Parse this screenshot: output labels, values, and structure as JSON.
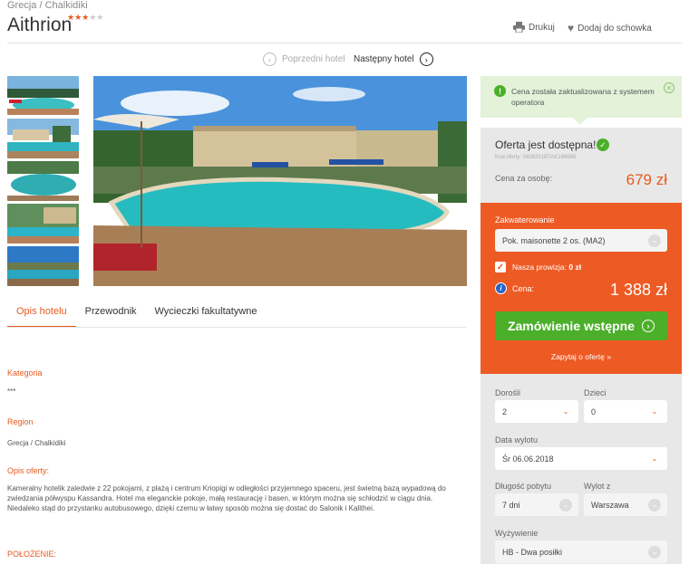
{
  "breadcrumb": "Grecja / Chalkidiki",
  "hotel_name": "Aithrion",
  "rating": {
    "stars_on": 3,
    "stars_total": 5
  },
  "actions": {
    "print": "Drukuj",
    "favourite": "Dodaj do schowka"
  },
  "pager": {
    "prev": "Poprzedni hotel",
    "next": "Następny hotel"
  },
  "tabs": [
    "Opis hotelu",
    "Przewodnik",
    "Wycieczki fakultatywne"
  ],
  "description": {
    "category_label": "Kategoria",
    "category_value": "***",
    "region_label": "Region",
    "region_value": "Grecja / Chalkidiki",
    "offer_label": "Opis oferty:",
    "offer_text": "Kameralny hotelik zaledwie z 22 pokojami, z plażą i centrum Kriopigi w odległości przyjemnego spaceru, jest świetną bazą wypadową do zwiedzania półwyspu Kassandra. Hotel ma eleganckie pokoje, małą restaurację i basen, w którym można się schłodzić w ciągu dnia. Niedaleko stąd do przystanku autobusowego, dzięki czemu w łatwy sposób można się dostać do Salonik i Kalithei.",
    "location_label": "POŁOŻENIE:"
  },
  "notice": "Cena została zaktualizowana z systemem operatora",
  "offer": {
    "available": "Oferta jest dostępna!",
    "code": "Kod oferty: 0606201BTAK168685",
    "price_label": "Cena za osobę:",
    "price": "679 zł"
  },
  "booking": {
    "accommodation_label": "Zakwaterowanie",
    "accommodation_value": "Pok. maisonette 2 os. (MA2)",
    "commission_label": "Nasza prowizja:",
    "commission_value": "0 zł",
    "total_label": "Cena:",
    "total": "1 388 zł",
    "order_button": "Zamówienie wstępne",
    "ask_link": "Zapytaj o ofertę »"
  },
  "form": {
    "adults_label": "Dorośli",
    "adults": "2",
    "children_label": "Dzieci",
    "children": "0",
    "date_label": "Data wylotu",
    "date": "Śr 06.06.2018",
    "length_label": "Długość pobytu",
    "length": "7 dni",
    "departure_label": "Wylot z",
    "departure": "Warszawa",
    "board_label": "Wyżywienie",
    "board": "HB - Dwa posiłki"
  },
  "colors": {
    "accent": "#ee5a24",
    "green": "#4caf2a",
    "notice_bg": "#e3f2d9"
  }
}
